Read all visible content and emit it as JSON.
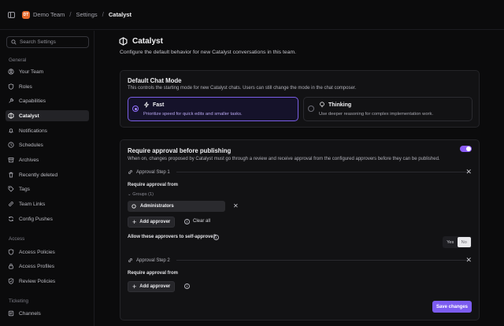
{
  "topbar": {
    "team_initials": "DT",
    "team_name": "Demo Team",
    "settings": "Settings",
    "current": "Catalyst"
  },
  "sidebar": {
    "search_placeholder": "Search Settings",
    "sections": [
      {
        "label": "General",
        "items": [
          "Your Team",
          "Roles",
          "Capabilities",
          "Catalyst",
          "Notifications",
          "Schedules",
          "Archives",
          "Recently deleted",
          "Tags",
          "Team Links",
          "Config Pushes"
        ]
      },
      {
        "label": "Access",
        "items": [
          "Access Policies",
          "Access Profiles",
          "Review Policies"
        ]
      },
      {
        "label": "Ticketing",
        "items": [
          "Channels"
        ]
      }
    ],
    "active": "Catalyst"
  },
  "page": {
    "title": "Catalyst",
    "description": "Configure the default behavior for new Catalyst conversations in this team."
  },
  "chat_mode": {
    "title": "Default Chat Mode",
    "subtitle": "This controls the starting mode for new Catalyst chats. Users can still change the mode in the chat composer.",
    "options": [
      {
        "title": "Fast",
        "desc": "Prioritize speed for quick edits and smaller tasks.",
        "selected": true,
        "icon": "bolt-icon"
      },
      {
        "title": "Thinking",
        "desc": "Use deeper reasoning for complex implementation work.",
        "selected": false,
        "icon": "lightbulb-icon"
      }
    ]
  },
  "approval": {
    "title": "Require approval before publishing",
    "subtitle": "When on, changes proposed by Catalyst must go through a review and receive approval from the configured approvers before they can be published.",
    "enabled": true,
    "steps": [
      {
        "label": "Approval Step 1",
        "require_label": "Require approval from",
        "groups_label": "Groups (1)",
        "groups": [
          "Administrators"
        ],
        "add_label": "Add approver",
        "clear_label": "Clear all",
        "self_approve_question": "Allow these approvers to self-approve?",
        "yes_label": "Yes",
        "no_label": "No",
        "self_approve": "No"
      },
      {
        "label": "Approval Step 2",
        "require_label": "Require approval from",
        "add_label": "Add approver"
      }
    ],
    "save_label": "Save changes"
  },
  "colors": {
    "accent": "#7c5cf0",
    "team_logo": "#e66a2c",
    "background": "#0b0b0c"
  }
}
